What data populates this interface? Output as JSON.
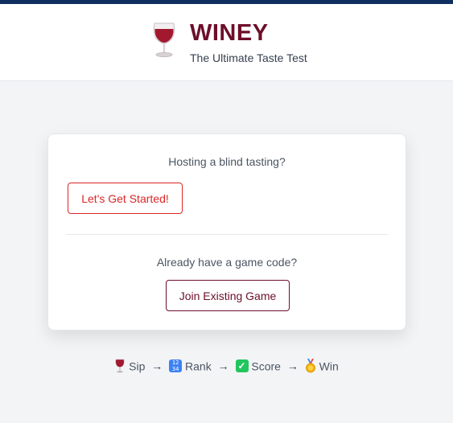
{
  "header": {
    "title": "WINEY",
    "tagline": "The Ultimate Taste Test",
    "logo_icon": "wine-glass-icon"
  },
  "card": {
    "host_prompt": "Hosting a blind tasting?",
    "start_label": "Let's Get Started!",
    "join_prompt": "Already have a game code?",
    "join_label": "Join Existing Game"
  },
  "flow": {
    "steps": [
      {
        "icon": "wine-glass-icon",
        "label": "Sip"
      },
      {
        "icon": "rank-numbers-icon",
        "label": "Rank"
      },
      {
        "icon": "check-mark-icon",
        "label": "Score"
      },
      {
        "icon": "medal-icon",
        "label": "Win"
      }
    ],
    "separator": "→"
  },
  "colors": {
    "brand": "#6d0f2a",
    "accent_red": "#dc2626",
    "top_stripe": "#0f2f5f",
    "background": "#f3f4f6"
  }
}
